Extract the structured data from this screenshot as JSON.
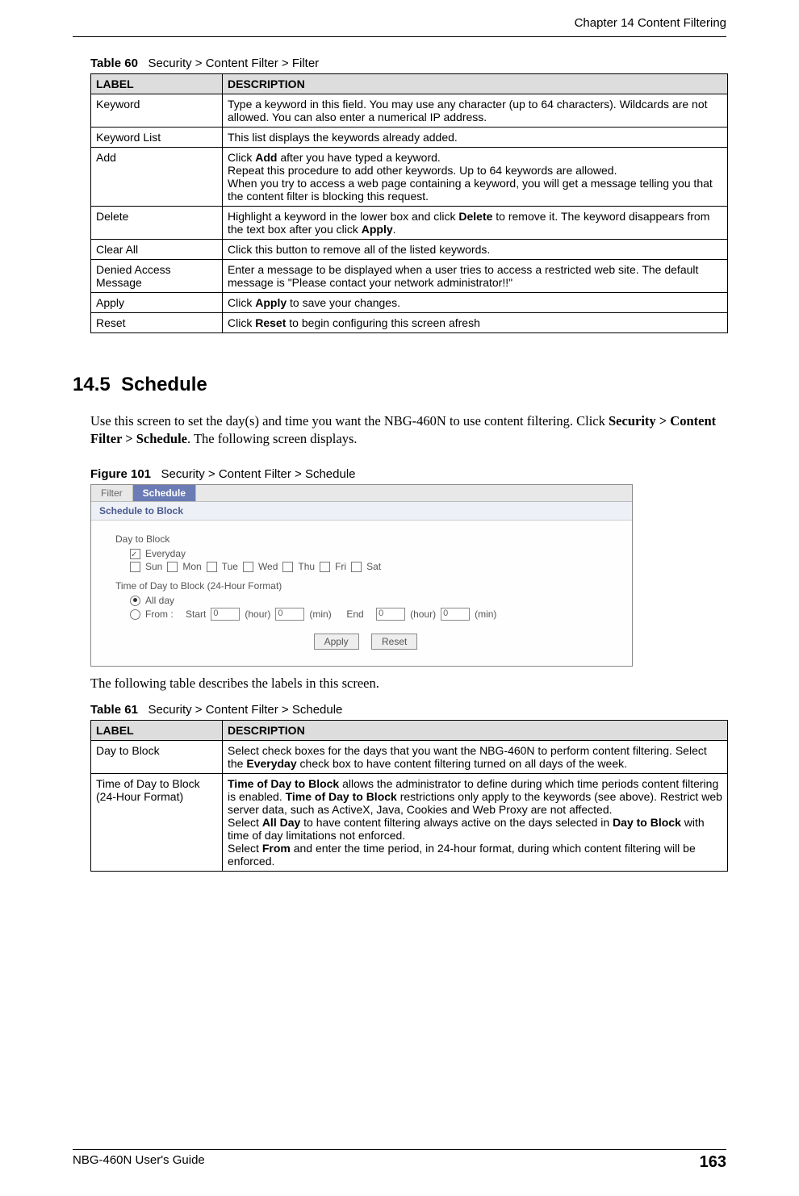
{
  "header": {
    "chapter": "Chapter 14 Content Filtering"
  },
  "table60": {
    "caption_label": "Table 60",
    "caption_text": "Security > Content Filter > Filter",
    "head_label": "LABEL",
    "head_desc": "DESCRIPTION",
    "rows": [
      {
        "label": "Keyword",
        "desc": "Type a keyword in this field. You may use any character (up to 64 characters). Wildcards are not allowed. You can also enter a numerical IP address."
      },
      {
        "label": "Keyword List",
        "desc": "This list displays the keywords already added."
      },
      {
        "label": "Add",
        "desc_p1": "Click ",
        "desc_b1": "Add",
        "desc_p2": " after you have typed a keyword.",
        "desc_p3": "Repeat this procedure to add other keywords. Up to 64 keywords are allowed.",
        "desc_p4": "When you try to access a web page containing a keyword, you will get a message telling you that the content filter is blocking this request."
      },
      {
        "label": "Delete",
        "desc_p1": "Highlight a keyword in the lower box and click ",
        "desc_b1": "Delete",
        "desc_p2": " to remove it. The keyword disappears from the text box after you click ",
        "desc_b2": "Apply",
        "desc_p3": "."
      },
      {
        "label": "Clear All",
        "desc": "Click this button to remove all of the listed keywords."
      },
      {
        "label": "Denied Access Message",
        "desc": "Enter a message to be displayed when a user tries to access a restricted web site. The default message is \"Please contact your network administrator!!\""
      },
      {
        "label": "Apply",
        "desc_p1": "Click ",
        "desc_b1": "Apply",
        "desc_p2": " to save your changes."
      },
      {
        "label": "Reset",
        "desc_p1": "Click ",
        "desc_b1": "Reset",
        "desc_p2": " to begin configuring this screen afresh"
      }
    ]
  },
  "section": {
    "number": "14.5",
    "title": "Schedule",
    "para1_a": "Use this screen to set the day(s) and time you want the NBG-460N to use content filtering. Click ",
    "para1_b": "Security > Content Filter > Schedule",
    "para1_c": ". The following screen displays."
  },
  "figure": {
    "caption_label": "Figure 101",
    "caption_text": "Security > Content Filter > Schedule",
    "tab_filter": "Filter",
    "tab_schedule": "Schedule",
    "panel_title": "Schedule to Block",
    "day_label": "Day to Block",
    "everyday": "Everyday",
    "days": {
      "sun": "Sun",
      "mon": "Mon",
      "tue": "Tue",
      "wed": "Wed",
      "thu": "Thu",
      "fri": "Fri",
      "sat": "Sat"
    },
    "time_label": "Time of Day to Block (24-Hour Format)",
    "allday": "All day",
    "from": "From :",
    "start": "Start",
    "hour": "(hour)",
    "min": "(min)",
    "end": "End",
    "zero": "0",
    "apply": "Apply",
    "reset": "Reset"
  },
  "after_fig": "The following table describes the labels in this screen.",
  "table61": {
    "caption_label": "Table 61",
    "caption_text": "Security > Content Filter > Schedule",
    "head_label": "LABEL",
    "head_desc": "DESCRIPTION",
    "rows": [
      {
        "label": "Day to Block",
        "desc_p1": "Select check boxes for the days that you want the NBG-460N to perform content filtering. Select the ",
        "desc_b1": "Everyday",
        "desc_p2": " check box to have content filtering turned on all days of the week."
      },
      {
        "label": "Time of Day to Block (24-Hour Format)",
        "desc_b1": "Time of Day to Block",
        "desc_p1": " allows the administrator to define during which time periods content filtering is enabled. ",
        "desc_b2": "Time of Day to Block",
        "desc_p2": " restrictions only apply to the keywords (see above). Restrict web server data, such as ActiveX, Java, Cookies and Web Proxy are not affected.",
        "desc_p3a": "Select  ",
        "desc_b3": "All Day",
        "desc_p3b": " to have content filtering always active on the days selected in ",
        "desc_b4": "Day to Block",
        "desc_p3c": " with time of day limitations not enforced.",
        "desc_p4a": "Select ",
        "desc_b5": "From",
        "desc_p4b": " and enter the time period, in 24-hour format, during which content filtering will be enforced."
      }
    ]
  },
  "footer": {
    "guide": "NBG-460N User's Guide",
    "page": "163"
  }
}
